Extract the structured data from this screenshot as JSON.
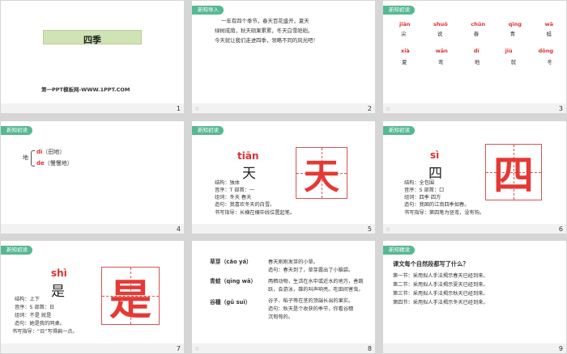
{
  "tag_text": "新知导入",
  "tag_text2": "新知初读",
  "tag_text3": "新知精读",
  "star": "☆",
  "slides": [
    {
      "num": "1",
      "title": "四季",
      "subtitle": "第一PPT模板网-WWW.1PPT.COM"
    },
    {
      "num": "2",
      "lines": [
        "一年有四个季节，春天百花盛开，夏天",
        "绿树成荫，秋天硕果累累，冬天白雪皑皑。",
        "今天就让我们走进四季，领略不同的风光吧！"
      ]
    },
    {
      "num": "3",
      "row1_py": [
        "jiān",
        "shuō",
        "chūn",
        "qīng",
        "wā"
      ],
      "row1_ch": [
        "尖",
        "说",
        "春",
        "青",
        "蛙"
      ],
      "row2_py": [
        "xià",
        "wān",
        "dì",
        "jiù",
        "dōng"
      ],
      "row2_ch": [
        "夏",
        "弯",
        "地",
        "就",
        "冬"
      ]
    },
    {
      "num": "4",
      "char": "地",
      "py1": "dì",
      "w1": "（田地）",
      "py2": "de",
      "w2": "（慢慢地）"
    },
    {
      "num": "5",
      "py": "tiān",
      "char": "天",
      "lines": [
        "结构：独体",
        "音序：T  部首：一",
        "组词：冬天  春天",
        "造句：我喜欢冬天的白雪。",
        "书写指导：长横在横中线位置起笔。"
      ]
    },
    {
      "num": "6",
      "py": "sì",
      "char": "四",
      "lines": [
        "结构：全包围",
        "音序：S  部首：口",
        "组词：四季  四方",
        "造句：我国的江南四季如春。",
        "书写指导：第四笔为竖弯，没有钩。"
      ]
    },
    {
      "num": "7",
      "py": "shì",
      "char": "是",
      "lines": [
        "结构：上下",
        "音序：S  部首：日",
        "组词：不是  就是",
        "造句：她是我的同桌。",
        "书写指导：“日”写得扁一点。"
      ]
    },
    {
      "num": "8",
      "items": [
        {
          "term": "草芽（cǎo yá）",
          "l1": "春天刚刚发芽的小草。",
          "l2": "造句：春天到了，草芽露出了小脑袋。"
        },
        {
          "term": "青蛙（qīng wā）",
          "l1": "两栖动物，生活在水中或近水的地方，善跳",
          "l2": "跃，会游泳，雄的叫声响亮。吃田间害虫。"
        },
        {
          "term": "谷穗（gǔ suì）",
          "l1": "谷子、稻子等在茎的顶端长出的果实。",
          "l2": "造句：秋天是个收获的季节，你看谷穗",
          "l3": "沉甸甸的。"
        }
      ]
    },
    {
      "num": "9",
      "title": "课文每个自然段都写了什么？",
      "lines": [
        "第一节：采用拟人手法揭示春天已经到来。",
        "第二节：采用拟人手法揭示夏天已经到来。",
        "第三节：采用拟人手法揭示秋天已经到来。",
        "第四节：采用拟人手法揭示冬天已经到来。"
      ]
    }
  ]
}
